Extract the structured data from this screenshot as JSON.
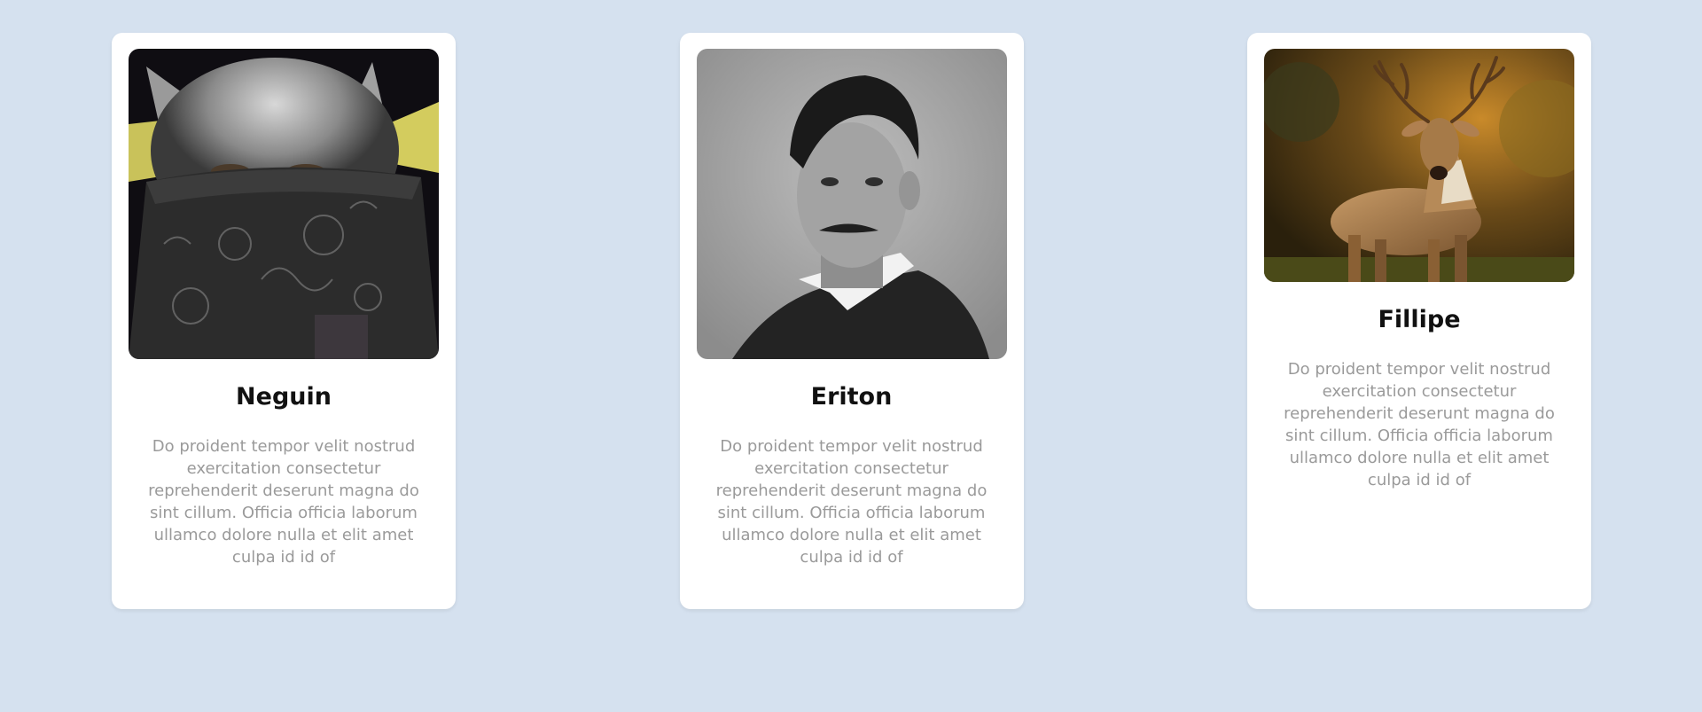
{
  "cards": [
    {
      "name": "Neguin",
      "description": "Do proident tempor velit nostrud exercitation consectetur reprehenderit deserunt magna do sint cillum. Officia officia laborum ullamco dolore nulla et elit amet culpa id id of",
      "image": "masked-cat-photo"
    },
    {
      "name": "Eriton",
      "description": "Do proident tempor velit nostrud exercitation consectetur reprehenderit deserunt magna do sint cillum. Officia officia laborum ullamco dolore nulla et elit amet culpa id id of",
      "image": "vintage-portrait-photo"
    },
    {
      "name": "Fillipe",
      "description": "Do proident tempor velit nostrud exercitation consectetur reprehenderit deserunt magna do sint cillum. Officia officia laborum ullamco dolore nulla et elit amet culpa id id of",
      "image": "deer-photo"
    }
  ],
  "colors": {
    "background": "#d5e1ef",
    "card": "#ffffff",
    "name_text": "#111111",
    "description_text": "#9a9a9a"
  }
}
